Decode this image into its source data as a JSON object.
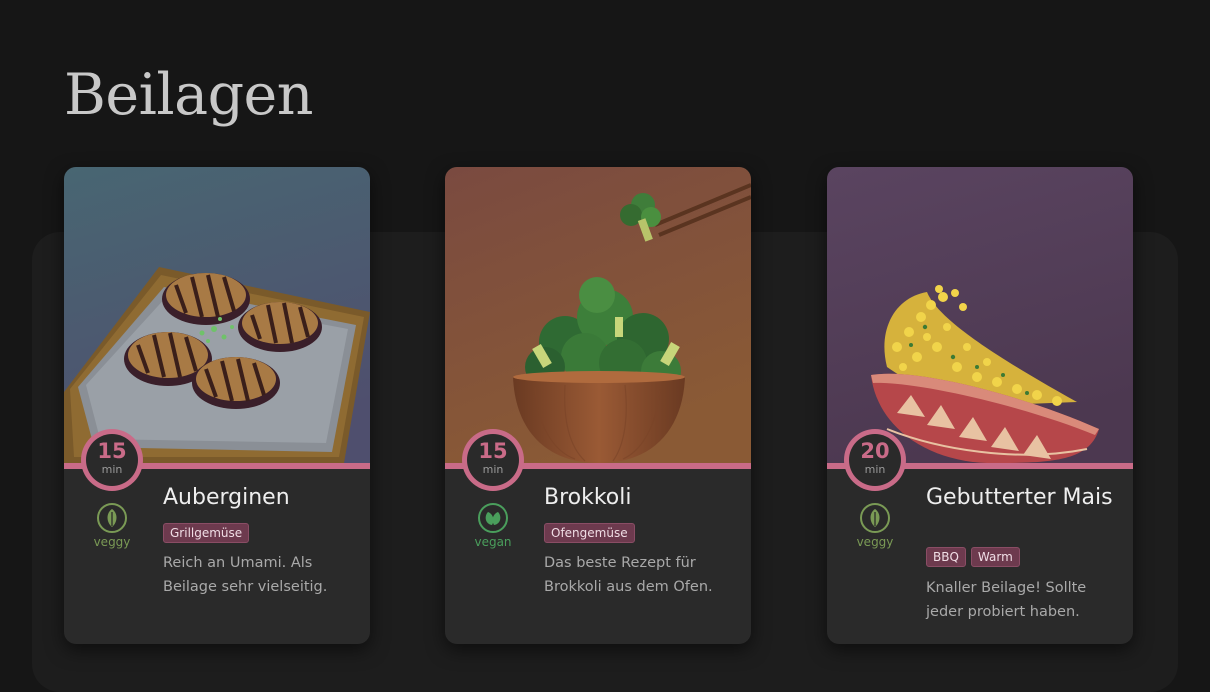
{
  "page": {
    "title": "Beilagen"
  },
  "colors": {
    "accent": "#c96b88",
    "veggy": "#7a9a55",
    "vegan": "#4a9e5c",
    "tag_bg": "#6d3a4e"
  },
  "cards": [
    {
      "title": "Auberginen",
      "time": "15",
      "time_unit": "min",
      "diet": "veggy",
      "diet_icon": "leaf-icon",
      "tags": [
        "Grillgemüse"
      ],
      "description": "Reich an Umami. Als Beilage sehr vielseitig.",
      "image": "grilled-eggplant-image"
    },
    {
      "title": "Brokkoli",
      "time": "15",
      "time_unit": "min",
      "diet": "vegan",
      "diet_icon": "double-leaf-icon",
      "tags": [
        "Ofengemüse"
      ],
      "description": "Das beste Rezept für Brokkoli aus dem Ofen.",
      "image": "broccoli-bowl-image"
    },
    {
      "title": "Gebutterter Mais",
      "time": "20",
      "time_unit": "min",
      "diet": "veggy",
      "diet_icon": "leaf-icon",
      "tags": [
        "BBQ",
        "Warm"
      ],
      "description": "Knaller Beilage! Sollte jeder probiert haben.",
      "image": "corn-bowl-image"
    }
  ]
}
